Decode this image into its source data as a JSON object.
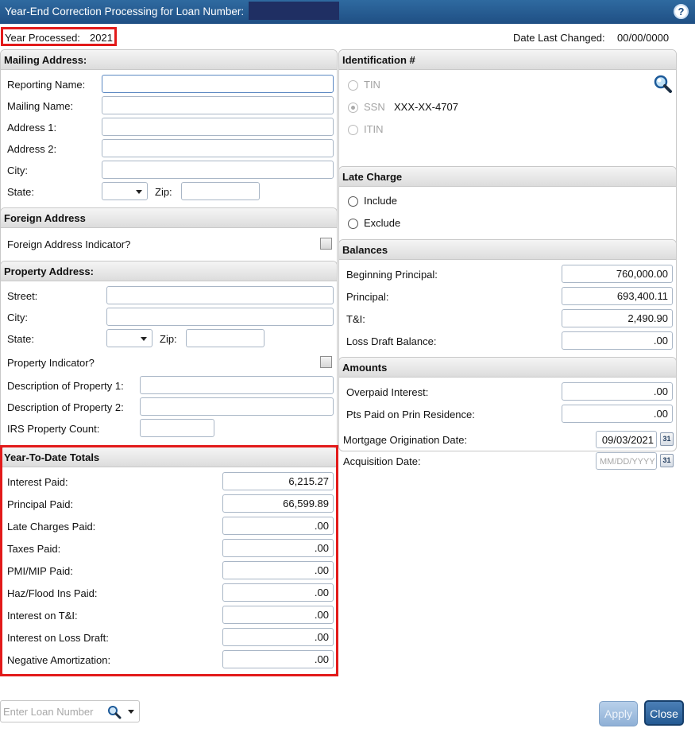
{
  "window": {
    "title": "Year-End Correction Processing for Loan Number:",
    "help_icon": "help-icon"
  },
  "header": {
    "year_label": "Year Processed:",
    "year_value": "2021",
    "date_changed_label": "Date Last Changed:",
    "date_changed_value": "00/00/0000"
  },
  "mailing": {
    "title": "Mailing Address:",
    "reporting_name": "Reporting Name:",
    "mailing_name": "Mailing Name:",
    "address1": "Address 1:",
    "address2": "Address 2:",
    "city": "City:",
    "state": "State:",
    "zip": "Zip:"
  },
  "foreign": {
    "title": "Foreign Address",
    "indicator": "Foreign Address Indicator?"
  },
  "property": {
    "title": "Property Address:",
    "street": "Street:",
    "city": "City:",
    "state": "State:",
    "zip": "Zip:",
    "indicator": "Property Indicator?",
    "desc1": "Description of Property 1:",
    "desc2": "Description of Property 2:",
    "count": "IRS Property Count:"
  },
  "ytd": {
    "title": "Year-To-Date Totals",
    "rows": [
      {
        "label": "Interest Paid:",
        "value": "6,215.27"
      },
      {
        "label": "Principal Paid:",
        "value": "66,599.89"
      },
      {
        "label": "Late Charges Paid:",
        "value": ".00"
      },
      {
        "label": "Taxes Paid:",
        "value": ".00"
      },
      {
        "label": "PMI/MIP Paid:",
        "value": ".00"
      },
      {
        "label": "Haz/Flood Ins Paid:",
        "value": ".00"
      },
      {
        "label": "Interest on T&I:",
        "value": ".00"
      },
      {
        "label": "Interest on Loss Draft:",
        "value": ".00"
      },
      {
        "label": "Negative Amortization:",
        "value": ".00"
      }
    ]
  },
  "identification": {
    "title": "Identification #",
    "tin": "TIN",
    "ssn": "SSN",
    "ssn_value": "XXX-XX-4707",
    "itin": "ITIN",
    "search_icon": "search-icon"
  },
  "late_charge": {
    "title": "Late Charge",
    "include": "Include",
    "exclude": "Exclude"
  },
  "balances": {
    "title": "Balances",
    "rows": [
      {
        "label": "Beginning Principal:",
        "value": "760,000.00"
      },
      {
        "label": "Principal:",
        "value": "693,400.11"
      },
      {
        "label": "T&I:",
        "value": "2,490.90"
      },
      {
        "label": "Loss Draft Balance:",
        "value": ".00"
      }
    ]
  },
  "amounts": {
    "title": "Amounts",
    "rows": [
      {
        "label": "Overpaid Interest:",
        "value": ".00"
      },
      {
        "label": "Pts Paid on Prin Residence:",
        "value": ".00"
      }
    ]
  },
  "dates": {
    "origination_label": "Mortgage Origination Date:",
    "origination_value": "09/03/2021",
    "acquisition_label": "Acquisition Date:",
    "acquisition_placeholder": "MM/DD/YYYY",
    "calendar_glyph": "31"
  },
  "footer": {
    "loan_placeholder": "Enter Loan Number",
    "apply": "Apply",
    "close": "Close"
  }
}
